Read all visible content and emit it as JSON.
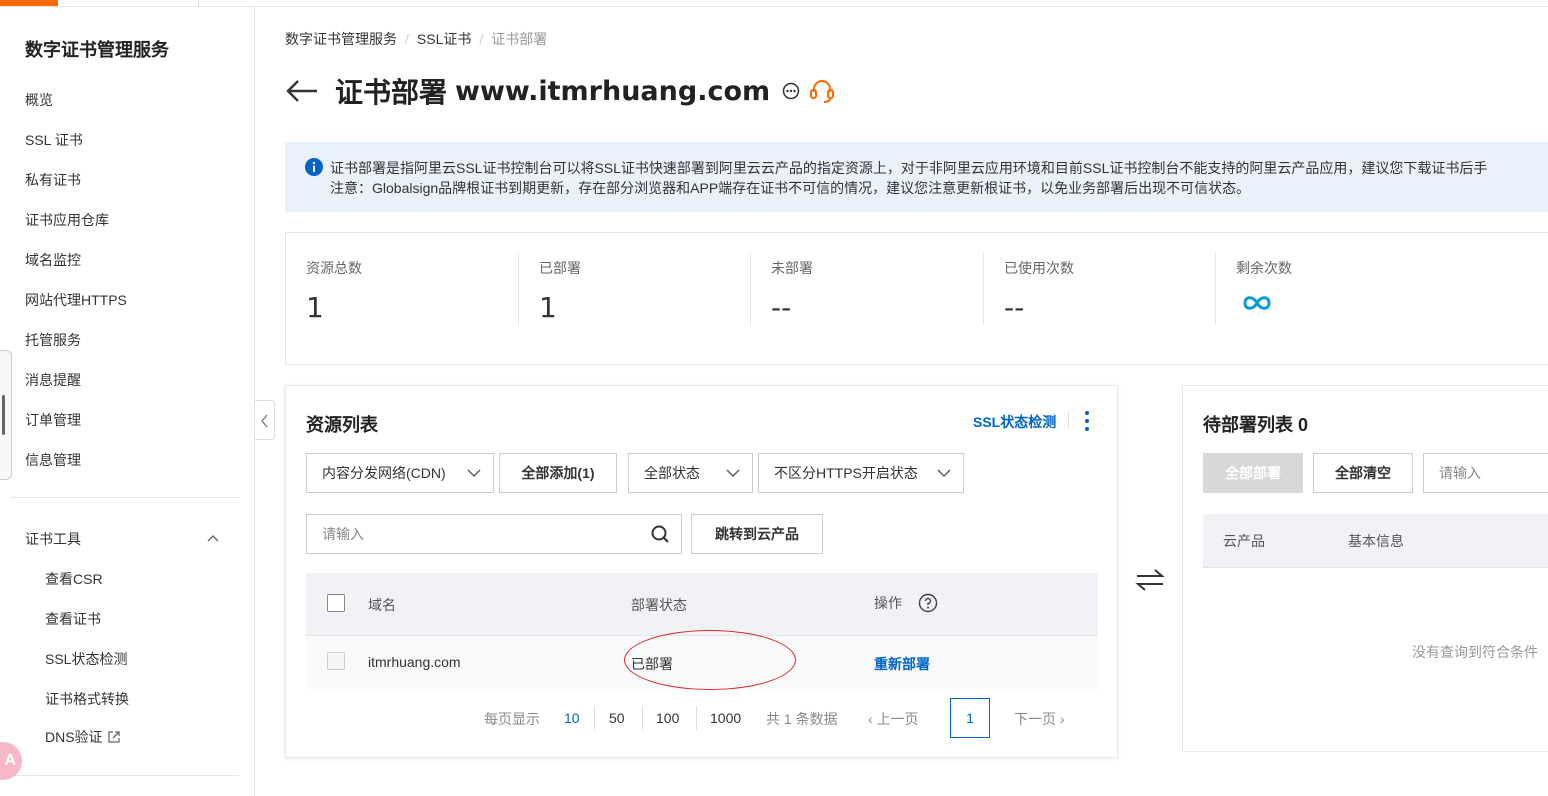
{
  "colors": {
    "accent": "#ff6a00",
    "link": "#0064c8",
    "notice_bg": "#ebf1fb",
    "annotation": "#d9262c"
  },
  "sidebar": {
    "title": "数字证书管理服务",
    "items": [
      {
        "label": "概览"
      },
      {
        "label": "SSL 证书"
      },
      {
        "label": "私有证书"
      },
      {
        "label": "证书应用仓库"
      },
      {
        "label": "域名监控"
      },
      {
        "label": "网站代理HTTPS"
      },
      {
        "label": "托管服务"
      },
      {
        "label": "消息提醒"
      },
      {
        "label": "订单管理"
      },
      {
        "label": "信息管理"
      }
    ],
    "tools_group": {
      "label": "证书工具",
      "items": [
        {
          "label": "查看CSR"
        },
        {
          "label": "查看证书"
        },
        {
          "label": "SSL状态检测"
        },
        {
          "label": "证书格式转换"
        },
        {
          "label": "DNS验证"
        }
      ]
    },
    "avatar_text": "A"
  },
  "breadcrumb": [
    "数字证书管理服务",
    "SSL证书",
    "证书部署"
  ],
  "header": {
    "title": "证书部署",
    "domain": "www.itmrhuang.com"
  },
  "notice": {
    "line1": "证书部署是指阿里云SSL证书控制台可以将SSL证书快速部署到阿里云云产品的指定资源上，对于非阿里云应用环境和目前SSL证书控制台不能支持的阿里云产品应用，建议您下载证书后手",
    "line2": "注意：Globalsign品牌根证书到期更新，存在部分浏览器和APP端存在证书不可信的情况，建议您注意更新根证书，以免业务部署后出现不可信状态。"
  },
  "stats": [
    {
      "label": "资源总数",
      "value": "1"
    },
    {
      "label": "已部署",
      "value": "1"
    },
    {
      "label": "未部署",
      "value": "--"
    },
    {
      "label": "已使用次数",
      "value": "--"
    },
    {
      "label": "剩余次数",
      "value": "",
      "icon": "infinity-icon"
    }
  ],
  "resource_list": {
    "title": "资源列表",
    "ssl_check_link": "SSL状态检测",
    "product_select": "内容分发网络(CDN)",
    "add_all_button": "全部添加(1)",
    "status_select": "全部状态",
    "https_select": "不区分HTTPS开启状态",
    "search_placeholder": "请输入",
    "jump_button": "跳转到云产品",
    "columns": [
      "域名",
      "部署状态",
      "操作"
    ],
    "rows": [
      {
        "domain": "itmrhuang.com",
        "status": "已部署",
        "action": "重新部署"
      }
    ],
    "pagination": {
      "per_page_label": "每页显示",
      "sizes": [
        "10",
        "50",
        "100",
        "1000"
      ],
      "selected_size": "10",
      "total": "共 1 条数据",
      "prev": "上一页",
      "page": "1",
      "next": "下一页"
    }
  },
  "pending_list": {
    "title": "待部署列表 0",
    "deploy_all_button": "全部部署",
    "clear_all_button": "全部清空",
    "search_placeholder": "请输入",
    "columns": [
      "云产品",
      "基本信息"
    ],
    "empty_text": "没有查询到符合条件"
  }
}
